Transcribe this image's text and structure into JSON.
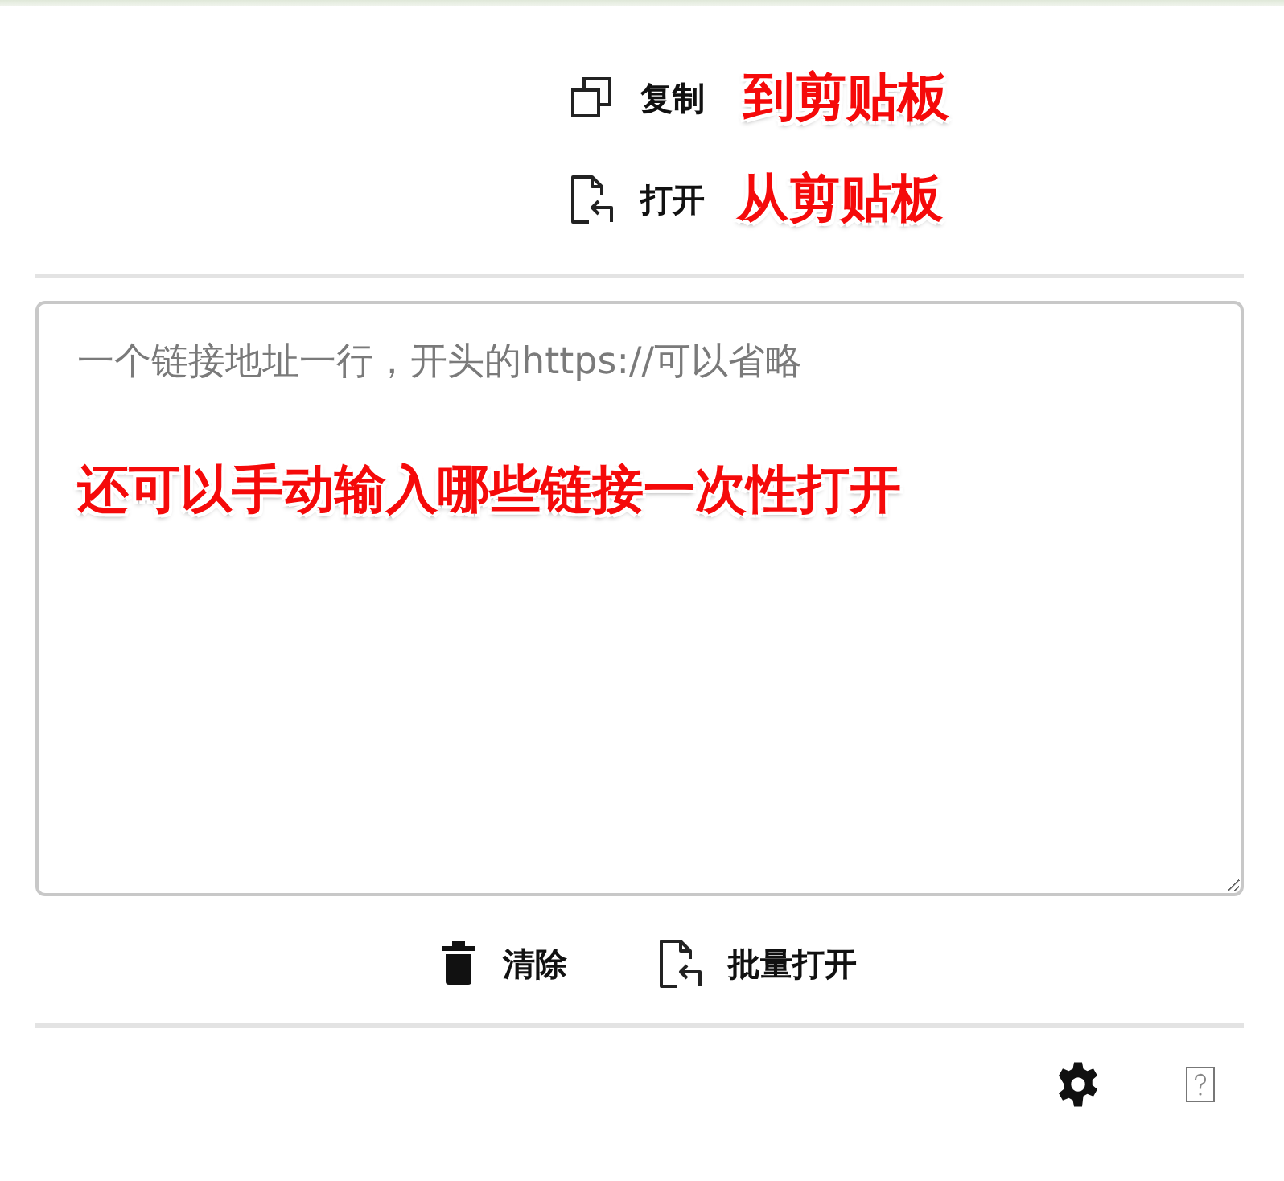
{
  "top_actions": [
    {
      "kind": "copy",
      "label": "复制",
      "annotation": "到剪贴板"
    },
    {
      "kind": "open",
      "label": "打开",
      "annotation": "从剪贴板"
    }
  ],
  "links_field": {
    "placeholder": "一个链接地址一行，开头的https://可以省略",
    "annotation": "还可以手动输入哪些链接一次性打开"
  },
  "bottom_actions": [
    {
      "kind": "clear",
      "label": "清除"
    },
    {
      "kind": "open",
      "label": "批量打开"
    }
  ],
  "footer_icons": [
    {
      "kind": "settings"
    },
    {
      "kind": "help"
    }
  ]
}
